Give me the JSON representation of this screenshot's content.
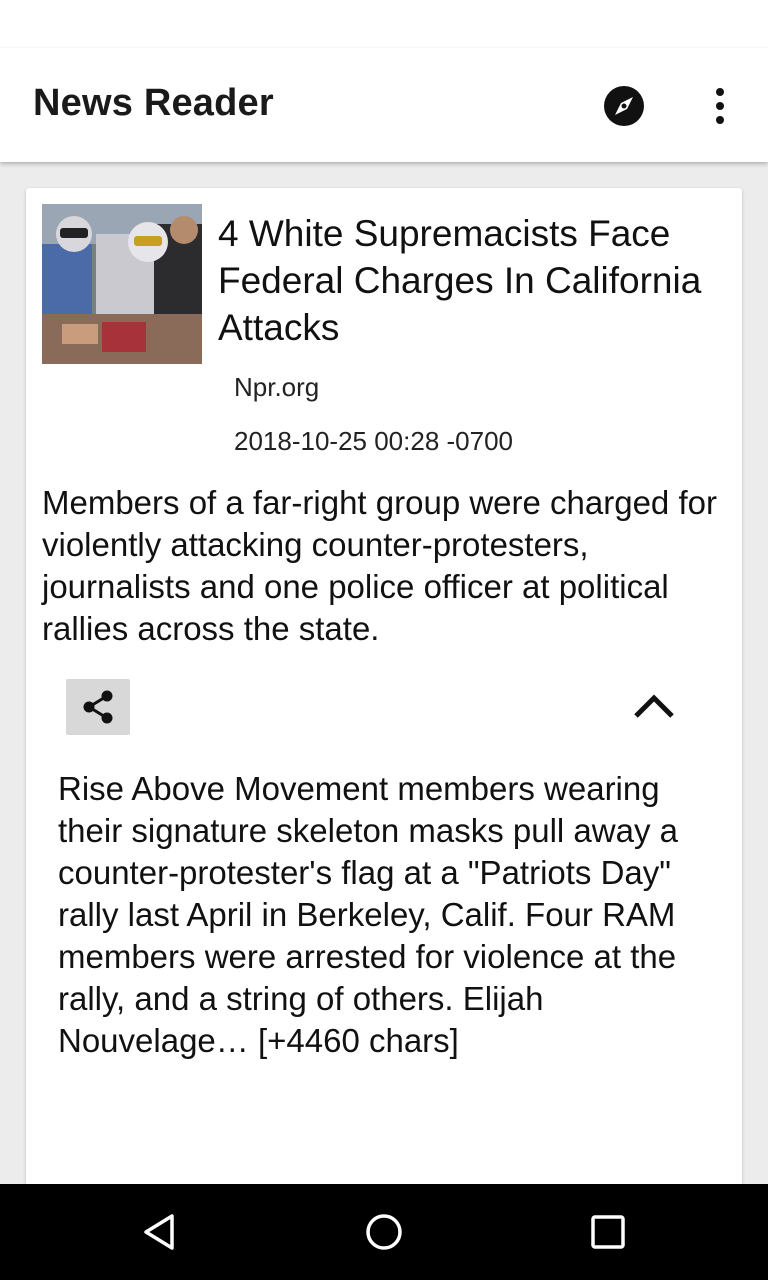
{
  "app": {
    "title": "News Reader",
    "icons": {
      "explore": "compass-icon",
      "overflow": "more-vert-icon"
    }
  },
  "article": {
    "image_alt": "Masked men wearing skeleton masks at a rally",
    "title": "4 White Supremacists Face Federal Charges In California Attacks",
    "source": "Npr.org",
    "published": "2018-10-25 00:28 -0700",
    "description": "Members of a far-right group were charged for violently attacking counter-protesters, journalists and one police officer at political rallies across the state.",
    "content": "Rise Above Movement members wearing their signature skeleton masks pull away a counter-protester's flag at a \"Patriots Day\" rally last April in Berkeley, Calif. Four RAM members were arrested for violence at the rally, and a string of others. Elijah Nouvelage… [+4460 chars]",
    "actions": {
      "share": "share-icon",
      "collapse": "chevron-up-icon"
    }
  },
  "navigation": {
    "back": "back-icon",
    "home": "home-icon",
    "recents": "recents-icon"
  },
  "colors": {
    "appbar": "#ffffff",
    "background": "#ececec",
    "share_button_bg": "#d8d8d8",
    "navbar": "#000000"
  }
}
